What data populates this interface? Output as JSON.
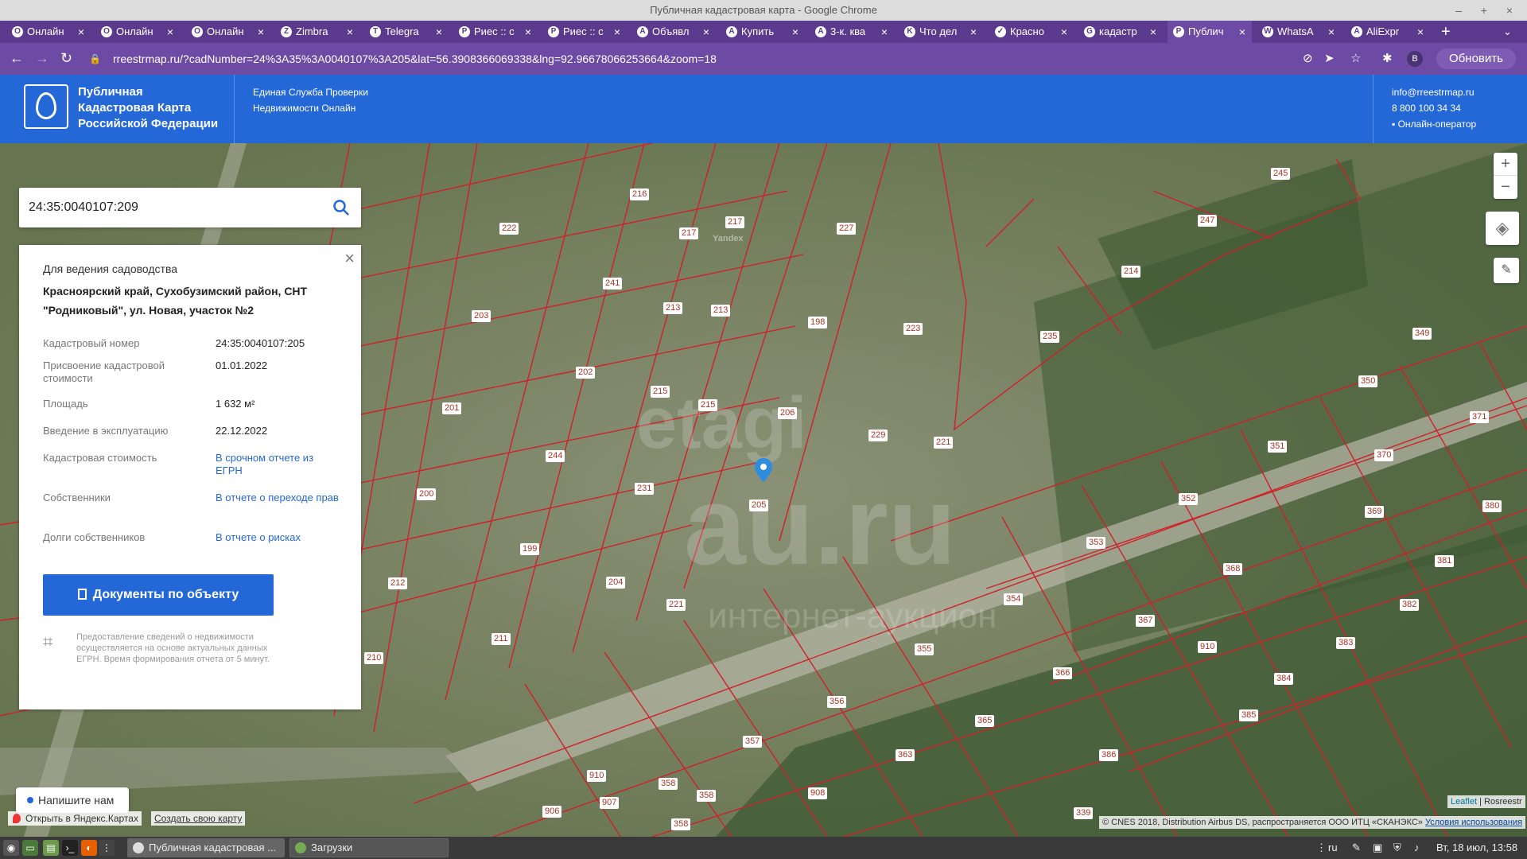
{
  "window": {
    "title": "Публичная кадастровая карта - Google Chrome"
  },
  "tabs": [
    {
      "label": "Онлайн",
      "icon": "O"
    },
    {
      "label": "Онлайн",
      "icon": "O"
    },
    {
      "label": "Онлайн",
      "icon": "O"
    },
    {
      "label": "Zimbra",
      "icon": "Z"
    },
    {
      "label": "Telegra",
      "icon": "T"
    },
    {
      "label": "Риес :: с",
      "icon": "Р"
    },
    {
      "label": "Риес :: с",
      "icon": "Р"
    },
    {
      "label": "Объявл",
      "icon": "A"
    },
    {
      "label": "Купить",
      "icon": "A"
    },
    {
      "label": "3-к. ква",
      "icon": "A"
    },
    {
      "label": "Что дел",
      "icon": "K"
    },
    {
      "label": "Красно",
      "icon": "✓"
    },
    {
      "label": "кадастр",
      "icon": "G"
    },
    {
      "label": "Публич",
      "icon": "P"
    },
    {
      "label": "WhatsA",
      "icon": "W"
    },
    {
      "label": "AliExpr",
      "icon": "A"
    }
  ],
  "toolbar": {
    "url": "rreestrmap.ru/?cadNumber=24%3A35%3A0040107%3A205&lat=56.3908366069338&lng=92.96678066253664&zoom=18",
    "update_label": "Обновить",
    "profile_letter": "В"
  },
  "header": {
    "title": "Публичная Кадастровая Карта Российской Федерации",
    "subtitle": "Единая Служба Проверки Недвижимости Онлайн",
    "email": "info@rreestrmap.ru",
    "phone": "8 800 100 34 34",
    "operator": "Онлайн-оператор"
  },
  "search": {
    "value": "24:35:0040107:209"
  },
  "card": {
    "purpose": "Для ведения садоводства",
    "address": "Красноярский край, Сухобузимский район, СНТ \"Родниковый\", ул. Новая, участок №2",
    "rows": [
      {
        "key": "Кадастровый номер",
        "value": "24:35:0040107:205",
        "link": false
      },
      {
        "key": "Присвоение кадастровой стоимости",
        "value": "01.01.2022",
        "link": false
      },
      {
        "key": "Площадь",
        "value": "1 632 м²",
        "link": false
      },
      {
        "key": "Введение в эксплуатацию",
        "value": "22.12.2022",
        "link": false
      },
      {
        "key": "Кадастровая стоимость",
        "value": "В срочном отчете из ЕГРН",
        "link": true
      },
      {
        "key": "Собственники",
        "value": "В отчете о переходе прав",
        "link": true
      },
      {
        "key": "Долги собственников",
        "value": "В отчете о рисках",
        "link": true
      }
    ],
    "doc_button": "Документы по объекту",
    "disclaimer": "Предоставление сведений о недвижимости осуществляется на основе актуальных данных ЕГРН. Время формирования отчета от 5 минут."
  },
  "map": {
    "plot_labels": [
      "216",
      "217",
      "227",
      "245",
      "247",
      "222",
      "217",
      "214",
      "241",
      "213",
      "213",
      "198",
      "223",
      "203",
      "235",
      "202",
      "215",
      "215",
      "349",
      "350",
      "201",
      "206",
      "229",
      "221",
      "371",
      "351",
      "370",
      "244",
      "231",
      "352",
      "380",
      "369",
      "200",
      "205",
      "353",
      "368",
      "381",
      "199",
      "212",
      "204",
      "221",
      "354",
      "367",
      "382",
      "211",
      "910",
      "383",
      "210",
      "355",
      "366",
      "384",
      "356",
      "385",
      "365",
      "357",
      "363",
      "386",
      "910",
      "358",
      "908",
      "907",
      "906",
      "358",
      "358",
      "339"
    ],
    "watermark_top": "etagi",
    "watermark_mid": "au.ru",
    "watermark_sub": "интернет-аукцион",
    "yandex_mark": "Yandex"
  },
  "controls": {
    "zoom_in": "+",
    "zoom_out": "−",
    "chat": "Напишите нам",
    "yandex_open": "Открыть в Яндекс.Картах",
    "create_map": "Создать свою карту",
    "attribution": "© CNES 2018, Distribution Airbus DS, распространяется ООО ИТЦ «СКАНЭКС»",
    "terms": "Условия использования",
    "leaflet": "Leaflet",
    "rosreestr": "Rosreestr"
  },
  "taskbar": {
    "tasks": [
      "Публичная кадастровая ...",
      "Загрузки"
    ],
    "lang": "ru",
    "clock": "Вт, 18 июл, 13:58"
  },
  "colors": {
    "brand": "#2468d8",
    "browser": "#6d4aa3",
    "plot_border": "#d0202a"
  }
}
